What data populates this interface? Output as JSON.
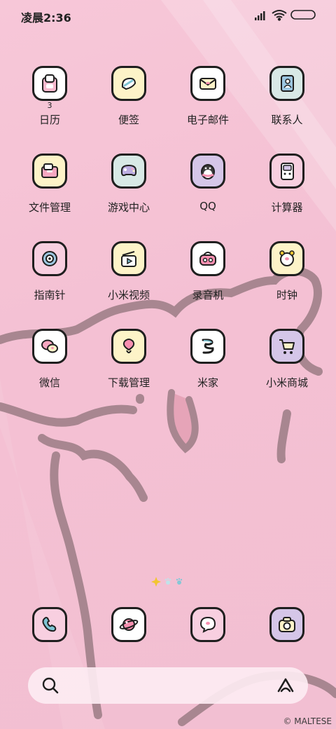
{
  "status": {
    "time": "凌晨2:36",
    "icons": [
      "signal-icon",
      "wifi-icon",
      "battery-icon"
    ]
  },
  "apps": [
    {
      "label": "日历",
      "icon": "calendar-icon",
      "bg": "#ffffff",
      "badge": "3"
    },
    {
      "label": "便签",
      "icon": "notes-icon",
      "bg": "#fdf3c8"
    },
    {
      "label": "电子邮件",
      "icon": "mail-icon",
      "bg": "#ffffff"
    },
    {
      "label": "联系人",
      "icon": "contacts-icon",
      "bg": "#d8e9e6"
    },
    {
      "label": "文件管理",
      "icon": "folder-icon",
      "bg": "#fdf3c8"
    },
    {
      "label": "游戏中心",
      "icon": "gamepad-icon",
      "bg": "#d8e9e6"
    },
    {
      "label": "QQ",
      "icon": "penguin-icon",
      "bg": "#d5c6e8"
    },
    {
      "label": "计算器",
      "icon": "calculator-icon",
      "bg": "#f8cfe0"
    },
    {
      "label": "指南针",
      "icon": "compass-icon",
      "bg": "#f8cfe0"
    },
    {
      "label": "小米视频",
      "icon": "video-icon",
      "bg": "#fdf3c8"
    },
    {
      "label": "录音机",
      "icon": "recorder-icon",
      "bg": "#ffffff"
    },
    {
      "label": "时钟",
      "icon": "alarm-clock-icon",
      "bg": "#fdf3c8"
    },
    {
      "label": "微信",
      "icon": "wechat-icon",
      "bg": "#ffffff"
    },
    {
      "label": "下载管理",
      "icon": "download-icon",
      "bg": "#fdf3c8"
    },
    {
      "label": "米家",
      "icon": "mijia-icon",
      "bg": "#ffffff"
    },
    {
      "label": "小米商城",
      "icon": "shopping-cart-icon",
      "bg": "#d5c6e8"
    }
  ],
  "dock": [
    {
      "icon": "phone-icon",
      "bg": "#f8cfe0"
    },
    {
      "icon": "browser-planet-icon",
      "bg": "#ffffff"
    },
    {
      "icon": "message-bubble-icon",
      "bg": "#f8cfe0"
    },
    {
      "icon": "camera-icon",
      "bg": "#d5c6e8"
    }
  ],
  "search": {
    "search_icon": "search-icon",
    "assistant_icon": "assistant-icon"
  },
  "watermark": "© MALTESE",
  "colors": {
    "background": "#f4c0d3",
    "outline": "#1f1f1f",
    "scribble": "#a88690"
  }
}
